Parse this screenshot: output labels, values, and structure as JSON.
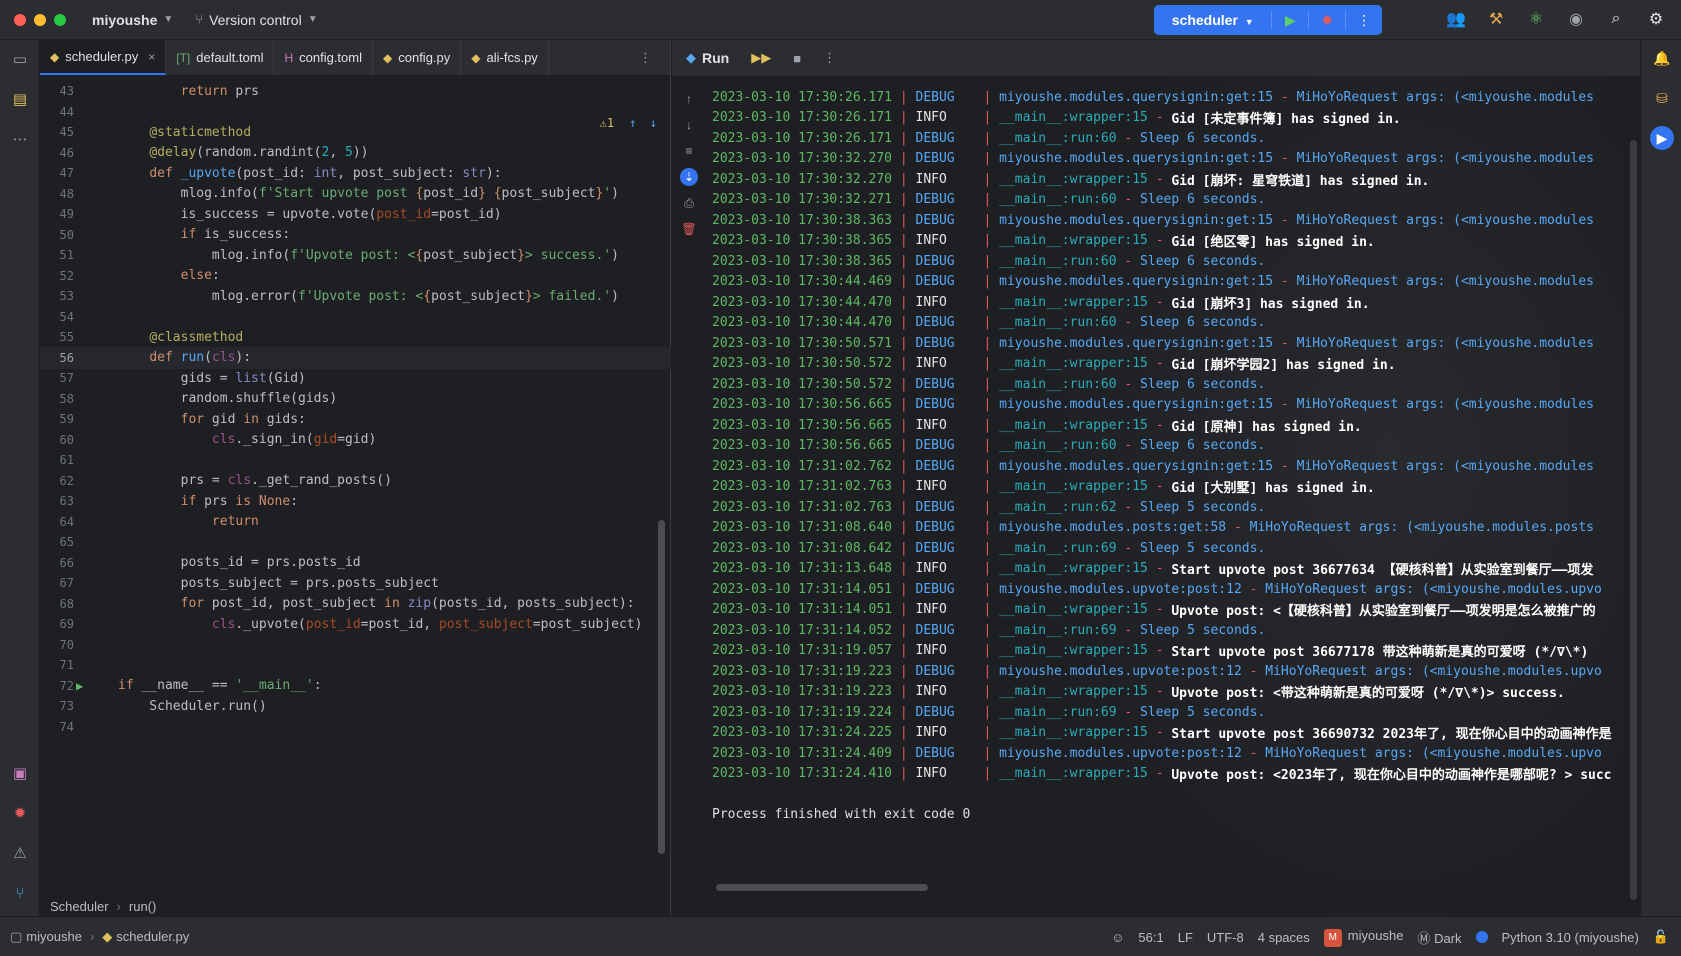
{
  "titlebar": {
    "project": "miyoushe",
    "vcs_label": "Version control",
    "run_config": "scheduler"
  },
  "editor": {
    "tabs": [
      {
        "label": "scheduler.py",
        "icon": "python-file-icon",
        "active": true
      },
      {
        "label": "default.toml",
        "icon": "toml-file-icon",
        "active": false
      },
      {
        "label": "config.toml",
        "icon": "toml-file-icon",
        "active": false
      },
      {
        "label": "config.py",
        "icon": "python-file-icon",
        "active": false
      },
      {
        "label": "ali-fcs.py",
        "icon": "python-file-icon",
        "active": false
      }
    ],
    "inspection_count": "1",
    "lines": [
      {
        "n": "43",
        "html": "        <span class=\"kw\">return</span> prs"
      },
      {
        "n": "44",
        "html": ""
      },
      {
        "n": "45",
        "html": "    <span class=\"dec\">@staticmethod</span>"
      },
      {
        "n": "46",
        "html": "    <span class=\"dec\">@delay</span>(random.randint(<span class=\"num\">2</span>, <span class=\"num\">5</span>))"
      },
      {
        "n": "47",
        "html": "    <span class=\"kw\">def</span> <span class=\"fn\">_upvote</span>(post_id: <span class=\"bi\">int</span>, post_subject: <span class=\"bi\">str</span>):"
      },
      {
        "n": "48",
        "html": "        mlog.info(<span class=\"str\">f'Start upvote post </span><span class=\"fmt\">{</span>post_id<span class=\"fmt\">}</span><span class=\"str\"> </span><span class=\"fmt\">{</span>post_subject<span class=\"fmt\">}</span><span class=\"str\">'</span>)"
      },
      {
        "n": "49",
        "html": "        is_success = upvote.vote(<span class=\"prm\">post_id</span>=post_id)"
      },
      {
        "n": "50",
        "html": "        <span class=\"kw\">if</span> is_success:"
      },
      {
        "n": "51",
        "html": "            mlog.info(<span class=\"str\">f'Upvote post: &lt;</span><span class=\"fmt\">{</span>post_subject<span class=\"fmt\">}</span><span class=\"str\">&gt; success.'</span>)"
      },
      {
        "n": "52",
        "html": "        <span class=\"kw\">else</span>:"
      },
      {
        "n": "53",
        "html": "            mlog.error(<span class=\"str\">f'Upvote post: &lt;</span><span class=\"fmt\">{</span>post_subject<span class=\"fmt\">}</span><span class=\"str\">&gt; failed.'</span>)"
      },
      {
        "n": "54",
        "html": ""
      },
      {
        "n": "55",
        "html": "    <span class=\"dec\">@classmethod</span>"
      },
      {
        "n": "56",
        "html": "    <span class=\"kw\">def</span> <span class=\"fn\">run</span>(<span class=\"slf\">cls</span>):",
        "current": true
      },
      {
        "n": "57",
        "html": "        gids = <span class=\"bi\">list</span>(Gid)"
      },
      {
        "n": "58",
        "html": "        random.shuffle(gids)"
      },
      {
        "n": "59",
        "html": "        <span class=\"kw\">for</span> gid <span class=\"kw\">in</span> gids:"
      },
      {
        "n": "60",
        "html": "            <span class=\"slf\">cls</span>._sign_in(<span class=\"prm\">gid</span>=gid)"
      },
      {
        "n": "61",
        "html": ""
      },
      {
        "n": "62",
        "html": "        prs = <span class=\"slf\">cls</span>._get_rand_posts()"
      },
      {
        "n": "63",
        "html": "        <span class=\"kw\">if</span> prs <span class=\"kw\">is</span> <span class=\"kw\">None</span>:"
      },
      {
        "n": "64",
        "html": "            <span class=\"kw\">return</span>"
      },
      {
        "n": "65",
        "html": ""
      },
      {
        "n": "66",
        "html": "        posts_id = prs.posts_id"
      },
      {
        "n": "67",
        "html": "        posts_subject = prs.posts_subject"
      },
      {
        "n": "68",
        "html": "        <span class=\"kw\">for</span> post_id, post_subject <span class=\"kw\">in</span> <span class=\"bi\">zip</span>(posts_id, posts_subject):"
      },
      {
        "n": "69",
        "html": "            <span class=\"slf\">cls</span>._upvote(<span class=\"prm\">post_id</span>=post_id, <span class=\"prm\">post_subject</span>=post_subject)"
      },
      {
        "n": "70",
        "html": ""
      },
      {
        "n": "71",
        "html": ""
      },
      {
        "n": "72",
        "html": "<span class=\"kw\">if</span> __name__ == <span class=\"str\">'__main__'</span>:",
        "run": true
      },
      {
        "n": "73",
        "html": "    Scheduler.run()"
      },
      {
        "n": "74",
        "html": ""
      }
    ],
    "breadcrumbs": [
      "Scheduler",
      "run()"
    ]
  },
  "run": {
    "title": "Run",
    "log": [
      {
        "ts": "2023-03-10 17:30:26.171",
        "lvl": "DEBUG",
        "mod": "miyoushe.modules.querysignin:get:15",
        "msg": "MiHoYoRequest args: (<miyoushe.modules"
      },
      {
        "ts": "2023-03-10 17:30:26.171",
        "lvl": "INFO",
        "mod": "__main__:wrapper:15",
        "msg": "Gid [未定事件簿] has signed in."
      },
      {
        "ts": "2023-03-10 17:30:26.171",
        "lvl": "DEBUG",
        "mod": "__main__:run:60",
        "msg": "Sleep 6 seconds."
      },
      {
        "ts": "2023-03-10 17:30:32.270",
        "lvl": "DEBUG",
        "mod": "miyoushe.modules.querysignin:get:15",
        "msg": "MiHoYoRequest args: (<miyoushe.modules"
      },
      {
        "ts": "2023-03-10 17:30:32.270",
        "lvl": "INFO",
        "mod": "__main__:wrapper:15",
        "msg": "Gid [崩坏: 星穹铁道] has signed in."
      },
      {
        "ts": "2023-03-10 17:30:32.271",
        "lvl": "DEBUG",
        "mod": "__main__:run:60",
        "msg": "Sleep 6 seconds."
      },
      {
        "ts": "2023-03-10 17:30:38.363",
        "lvl": "DEBUG",
        "mod": "miyoushe.modules.querysignin:get:15",
        "msg": "MiHoYoRequest args: (<miyoushe.modules"
      },
      {
        "ts": "2023-03-10 17:30:38.365",
        "lvl": "INFO",
        "mod": "__main__:wrapper:15",
        "msg": "Gid [绝区零] has signed in."
      },
      {
        "ts": "2023-03-10 17:30:38.365",
        "lvl": "DEBUG",
        "mod": "__main__:run:60",
        "msg": "Sleep 6 seconds."
      },
      {
        "ts": "2023-03-10 17:30:44.469",
        "lvl": "DEBUG",
        "mod": "miyoushe.modules.querysignin:get:15",
        "msg": "MiHoYoRequest args: (<miyoushe.modules"
      },
      {
        "ts": "2023-03-10 17:30:44.470",
        "lvl": "INFO",
        "mod": "__main__:wrapper:15",
        "msg": "Gid [崩坏3] has signed in."
      },
      {
        "ts": "2023-03-10 17:30:44.470",
        "lvl": "DEBUG",
        "mod": "__main__:run:60",
        "msg": "Sleep 6 seconds."
      },
      {
        "ts": "2023-03-10 17:30:50.571",
        "lvl": "DEBUG",
        "mod": "miyoushe.modules.querysignin:get:15",
        "msg": "MiHoYoRequest args: (<miyoushe.modules"
      },
      {
        "ts": "2023-03-10 17:30:50.572",
        "lvl": "INFO",
        "mod": "__main__:wrapper:15",
        "msg": "Gid [崩坏学园2] has signed in."
      },
      {
        "ts": "2023-03-10 17:30:50.572",
        "lvl": "DEBUG",
        "mod": "__main__:run:60",
        "msg": "Sleep 6 seconds."
      },
      {
        "ts": "2023-03-10 17:30:56.665",
        "lvl": "DEBUG",
        "mod": "miyoushe.modules.querysignin:get:15",
        "msg": "MiHoYoRequest args: (<miyoushe.modules"
      },
      {
        "ts": "2023-03-10 17:30:56.665",
        "lvl": "INFO",
        "mod": "__main__:wrapper:15",
        "msg": "Gid [原神] has signed in."
      },
      {
        "ts": "2023-03-10 17:30:56.665",
        "lvl": "DEBUG",
        "mod": "__main__:run:60",
        "msg": "Sleep 6 seconds."
      },
      {
        "ts": "2023-03-10 17:31:02.762",
        "lvl": "DEBUG",
        "mod": "miyoushe.modules.querysignin:get:15",
        "msg": "MiHoYoRequest args: (<miyoushe.modules"
      },
      {
        "ts": "2023-03-10 17:31:02.763",
        "lvl": "INFO",
        "mod": "__main__:wrapper:15",
        "msg": "Gid [大别墅] has signed in."
      },
      {
        "ts": "2023-03-10 17:31:02.763",
        "lvl": "DEBUG",
        "mod": "__main__:run:62",
        "msg": "Sleep 5 seconds."
      },
      {
        "ts": "2023-03-10 17:31:08.640",
        "lvl": "DEBUG",
        "mod": "miyoushe.modules.posts:get:58",
        "msg": "MiHoYoRequest args: (<miyoushe.modules.posts"
      },
      {
        "ts": "2023-03-10 17:31:08.642",
        "lvl": "DEBUG",
        "mod": "__main__:run:69",
        "msg": "Sleep 5 seconds."
      },
      {
        "ts": "2023-03-10 17:31:13.648",
        "lvl": "INFO",
        "mod": "__main__:wrapper:15",
        "msg": "Start upvote post 36677634 【硬核科普】从实验室到餐厅——项发"
      },
      {
        "ts": "2023-03-10 17:31:14.051",
        "lvl": "DEBUG",
        "mod": "miyoushe.modules.upvote:post:12",
        "msg": "MiHoYoRequest args: (<miyoushe.modules.upvo"
      },
      {
        "ts": "2023-03-10 17:31:14.051",
        "lvl": "INFO",
        "mod": "__main__:wrapper:15",
        "msg": "Upvote post: <【硬核科普】从实验室到餐厅——项发明是怎么被推广的"
      },
      {
        "ts": "2023-03-10 17:31:14.052",
        "lvl": "DEBUG",
        "mod": "__main__:run:69",
        "msg": "Sleep 5 seconds."
      },
      {
        "ts": "2023-03-10 17:31:19.057",
        "lvl": "INFO",
        "mod": "__main__:wrapper:15",
        "msg": "Start upvote post 36677178 带这种萌新是真的可爱呀 (*/∇\\*)"
      },
      {
        "ts": "2023-03-10 17:31:19.223",
        "lvl": "DEBUG",
        "mod": "miyoushe.modules.upvote:post:12",
        "msg": "MiHoYoRequest args: (<miyoushe.modules.upvo"
      },
      {
        "ts": "2023-03-10 17:31:19.223",
        "lvl": "INFO",
        "mod": "__main__:wrapper:15",
        "msg": "Upvote post: <带这种萌新是真的可爱呀 (*/∇\\*)> success."
      },
      {
        "ts": "2023-03-10 17:31:19.224",
        "lvl": "DEBUG",
        "mod": "__main__:run:69",
        "msg": "Sleep 5 seconds."
      },
      {
        "ts": "2023-03-10 17:31:24.225",
        "lvl": "INFO",
        "mod": "__main__:wrapper:15",
        "msg": "Start upvote post 36690732 2023年了, 现在你心目中的动画神作是"
      },
      {
        "ts": "2023-03-10 17:31:24.409",
        "lvl": "DEBUG",
        "mod": "miyoushe.modules.upvote:post:12",
        "msg": "MiHoYoRequest args: (<miyoushe.modules.upvo"
      },
      {
        "ts": "2023-03-10 17:31:24.410",
        "lvl": "INFO",
        "mod": "__main__:wrapper:15",
        "msg": "Upvote post: <2023年了, 现在你心目中的动画神作是哪部呢? > succ"
      }
    ],
    "finish": "Process finished with exit code 0"
  },
  "statusbar": {
    "crumb_project": "miyoushe",
    "crumb_file": "scheduler.py",
    "position": "56:1",
    "line_sep": "LF",
    "encoding": "UTF-8",
    "indent": "4 spaces",
    "profile_badge": "M",
    "profile": "miyoushe",
    "theme": "Dark",
    "interpreter": "Python 3.10 (miyoushe)"
  },
  "colors": {
    "accent": "#3574f0",
    "timestamp": "#5fb865",
    "debug": "#56a8f5",
    "separator": "#e05a5a"
  }
}
